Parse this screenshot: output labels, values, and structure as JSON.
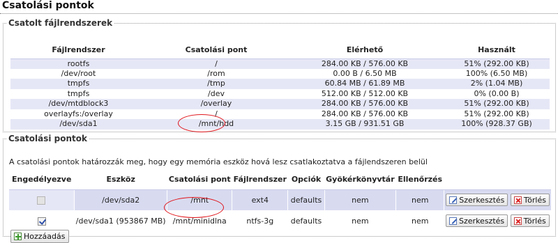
{
  "page_title": "Csatolási pontok",
  "mounted": {
    "legend": "Csatolt fájlrendszerek",
    "headers": [
      "Fájlrendszer",
      "Csatolási pont",
      "Elérhető",
      "Használt"
    ],
    "rows": [
      [
        "rootfs",
        "/",
        "284.00 KB / 576.00 KB",
        "51% (292.00 KB)"
      ],
      [
        "/dev/root",
        "/rom",
        "0.00 B / 6.50 MB",
        "100% (6.50 MB)"
      ],
      [
        "tmpfs",
        "/tmp",
        "60.84 MB / 61.89 MB",
        "2% (1.04 MB)"
      ],
      [
        "tmpfs",
        "/dev",
        "512.00 KB / 512.00 KB",
        "0% (0.00 B)"
      ],
      [
        "/dev/mtdblock3",
        "/overlay",
        "284.00 KB / 576.00 KB",
        "51% (292.00 KB)"
      ],
      [
        "overlayfs:/overlay",
        "/",
        "284.00 KB / 576.00 KB",
        "51% (292.00 KB)"
      ],
      [
        "/dev/sda1",
        "/mnt/hdd",
        "3.15 GB / 931.51 GB",
        "100% (928.37 GB)"
      ]
    ]
  },
  "mountpoints": {
    "legend": "Csatolási pontok",
    "description": "A csatolási pontok határozzák meg, hogy egy memória eszköz hová lesz csatlakoztatva a fájlendszeren belül",
    "headers": [
      "Engedélyezve",
      "Eszköz",
      "Csatolási pont",
      "Fájlrendszer",
      "Opciók",
      "Gyökérkönyvtár",
      "Ellenőrzés"
    ],
    "rows": [
      {
        "enabled": false,
        "device": "/dev/sda2",
        "mount": "/mnt",
        "fs": "ext4",
        "options": "defaults",
        "root": "nem",
        "check": "nem"
      },
      {
        "enabled": true,
        "device": "/dev/sda1 (953867 MB)",
        "mount": "/mnt/minidlna",
        "fs": "ntfs-3g",
        "options": "defaults",
        "root": "nem",
        "check": "nem"
      }
    ],
    "edit_label": "Szerkesztés",
    "delete_label": "Törlés",
    "add_label": "Hozzáadás"
  }
}
